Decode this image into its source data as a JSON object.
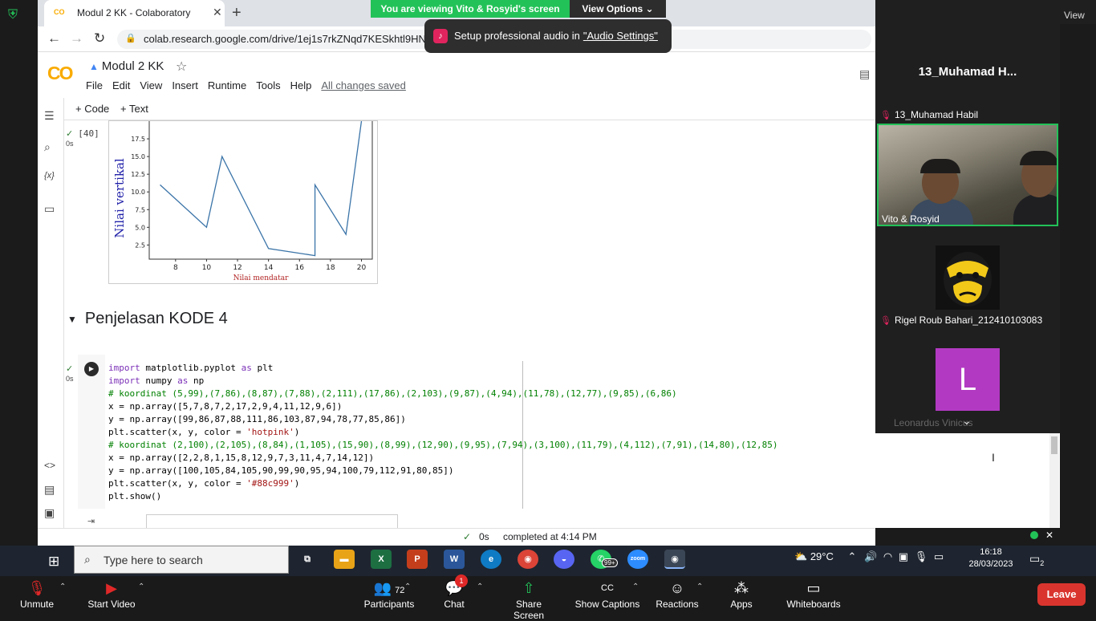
{
  "meeting": {
    "share_banner": "You are viewing Vito & Rosyid's screen",
    "view_options": "View Options",
    "audio_toast_text": "Setup professional audio in",
    "audio_toast_link": "\"Audio Settings\"",
    "view_label": "View"
  },
  "browser": {
    "tab_title": "Modul 2 KK - Colaboratory",
    "url": "colab.research.google.com/drive/1ej1s7rkZNqd7KESkhtl9HNO"
  },
  "colab": {
    "logo": "CO",
    "doc_title": "Modul 2 KK",
    "menu": [
      "File",
      "Edit",
      "View",
      "Insert",
      "Runtime",
      "Tools",
      "Help"
    ],
    "saved_status": "All changes saved",
    "add_code": "+ Code",
    "add_text": "+ Text",
    "cell_exec_count": "[40]",
    "cell_time": "0s",
    "section_title": "Penjelasan KODE 4",
    "code_time": "0s",
    "status_time": "0s",
    "status_text": "completed at 4:14 PM",
    "code_lines": [
      "import matplotlib.pyplot as plt",
      "import numpy as np",
      "# koordinat (5,99),(7,86),(8,87),(7,88),(2,111),(17,86),(2,103),(9,87),(4,94),(11,78),(12,77),(9,85),(6,86)",
      "x = np.array([5,7,8,7,2,17,2,9,4,11,12,9,6])",
      "y = np.array([99,86,87,88,111,86,103,87,94,78,77,85,86])",
      "plt.scatter(x, y, color = 'hotpink')",
      "# koordinat (2,100),(2,105),(8,84),(1,105),(15,90),(8,99),(12,90),(9,95),(7,94),(3,100),(11,79),(4,112),(7,91),(14,80),(12,85)",
      "x = np.array([2,2,8,1,15,8,12,9,7,3,11,4,7,14,12])",
      "y = np.array([100,105,84,105,90,99,90,95,94,100,79,112,91,80,85])",
      "plt.scatter(x, y, color = '#88c999')",
      "plt.show()"
    ]
  },
  "chart_data": {
    "type": "line",
    "x": [
      7,
      8,
      9,
      10,
      11,
      14,
      17,
      17,
      19,
      20
    ],
    "y": [
      11,
      9,
      7,
      5,
      15,
      2,
      1,
      11,
      4,
      20
    ],
    "xlabel": "Nilai mendatar",
    "ylabel": "Nilai vertikal",
    "xticks": [
      "8",
      "10",
      "12",
      "14",
      "16",
      "18",
      "20"
    ],
    "yticks": [
      "2.5",
      "5.0",
      "7.5",
      "10.0",
      "12.5",
      "15.0",
      "17.5"
    ],
    "xlim": [
      6.3,
      20.7
    ],
    "ylim": [
      0.5,
      20
    ],
    "line_color": "#3b74a8",
    "xlabel_color": "#b22222",
    "ylabel_color": "#2222aa"
  },
  "participants_panel": {
    "active_speaker": "13_Muhamad  H...",
    "p1_name": "13_Muhamad Habil",
    "video_label": "Vito & Rosyid",
    "p3_name": "Rigel Roub Bahari_212410103083",
    "p4_initial": "L",
    "p4_name": "Leonardus Vinicus"
  },
  "taskbar": {
    "search_placeholder": "Type here to search",
    "whatsapp_badge": "99+",
    "weather": "29°C",
    "time": "16:18",
    "date": "28/03/2023",
    "notif_count": "2"
  },
  "zoom_controls": {
    "unmute": "Unmute",
    "start_video": "Start Video",
    "participants": "Participants",
    "participants_count": "72",
    "chat": "Chat",
    "chat_badge": "1",
    "share_screen": "Share Screen",
    "show_captions": "Show Captions",
    "reactions": "Reactions",
    "apps": "Apps",
    "whiteboards": "Whiteboards",
    "leave": "Leave"
  },
  "colors": {
    "zoom_green": "#23c258",
    "leave_red": "#d9352e",
    "colab_orange": "#f9ab00",
    "avatar_purple": "#b23ac2"
  }
}
